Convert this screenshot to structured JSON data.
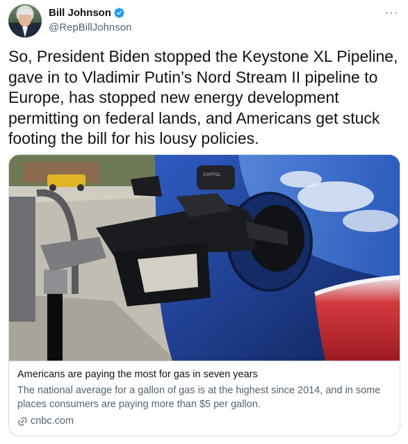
{
  "author": {
    "display_name": "Bill Johnson",
    "handle": "@RepBillJohnson",
    "verified": true
  },
  "more_label": "···",
  "tweet": {
    "text": "So, President Biden stopped the Keystone XL Pipeline, gave in to Vladimir Putin’s Nord Stream II pipeline to Europe, has stopped new energy development permitting on federal lands, and Americans get stuck footing the bill for his lousy policies."
  },
  "card": {
    "image_alt": "Gas pump nozzle inserted into a blue car's fuel tank",
    "image_text": "CAPITOL",
    "title": "Americans are paying the most for gas in seven years",
    "description": "The national average for a gallon of gas is at the highest since 2014, and in some places consumers are paying more than $5 per gallon.",
    "domain": "cnbc.com"
  },
  "colors": {
    "verified_blue": "#1d9bf0",
    "secondary_text": "#536471",
    "border": "#cfd9de",
    "car_blue": "#1f3f8f"
  }
}
